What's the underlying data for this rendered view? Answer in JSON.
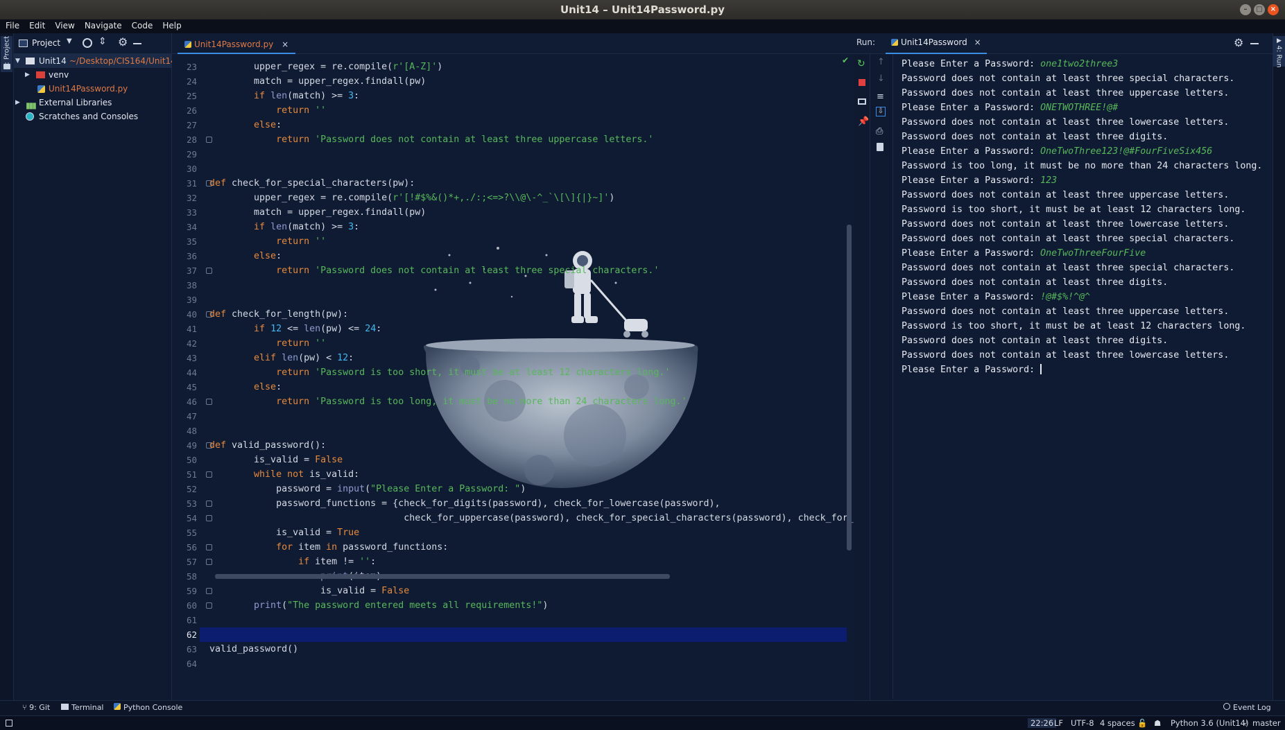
{
  "window": {
    "title": "Unit14 – Unit14Password.py"
  },
  "menu": [
    "File",
    "Edit",
    "View",
    "Navigate",
    "Code",
    "Help"
  ],
  "sidebar": {
    "project_tab": "1: Project"
  },
  "project": {
    "header": "Project",
    "root": {
      "name": "Unit14",
      "path": "~/Desktop/CIS164/Unit14"
    },
    "items": [
      {
        "label": "venv"
      },
      {
        "label": "Unit14Password.py"
      },
      {
        "label": "External Libraries"
      },
      {
        "label": "Scratches and Consoles"
      }
    ]
  },
  "editor": {
    "tab": "Unit14Password.py",
    "lines": [
      {
        "n": "23",
        "segs": [
          [
            "pl",
            "        upper_regex = re.compile("
          ],
          [
            "str",
            "r'[A-Z]'"
          ],
          [
            "pl",
            ")"
          ]
        ]
      },
      {
        "n": "24",
        "segs": [
          [
            "pl",
            "        match = upper_regex.findall(pw)"
          ]
        ]
      },
      {
        "n": "25",
        "segs": [
          [
            "kw",
            "        if "
          ],
          [
            "bi",
            "len"
          ],
          [
            "pl",
            "(match) >= "
          ],
          [
            "num",
            "3"
          ],
          [
            "pl",
            ":"
          ]
        ]
      },
      {
        "n": "26",
        "segs": [
          [
            "kw",
            "            return "
          ],
          [
            "str",
            "''"
          ]
        ]
      },
      {
        "n": "27",
        "segs": [
          [
            "kw",
            "        else"
          ],
          [
            "pl",
            ":"
          ]
        ]
      },
      {
        "n": "28",
        "segs": [
          [
            "kw",
            "            return "
          ],
          [
            "str",
            "'Password does not contain at least three uppercase letters.'"
          ]
        ]
      },
      {
        "n": "29",
        "segs": []
      },
      {
        "n": "30",
        "segs": []
      },
      {
        "n": "31",
        "segs": [
          [
            "kw",
            "def "
          ],
          [
            "fn",
            "check_for_special_characters"
          ],
          [
            "pl",
            "(pw):"
          ]
        ]
      },
      {
        "n": "32",
        "segs": [
          [
            "pl",
            "        upper_regex = re.compile("
          ],
          [
            "str",
            "r'[!#$%&()*+,./:;<=>?\\\\@\\-^_`\\[\\]{|}~]'"
          ],
          [
            "pl",
            ")"
          ]
        ]
      },
      {
        "n": "33",
        "segs": [
          [
            "pl",
            "        match = upper_regex.findall(pw)"
          ]
        ]
      },
      {
        "n": "34",
        "segs": [
          [
            "kw",
            "        if "
          ],
          [
            "bi",
            "len"
          ],
          [
            "pl",
            "(match) >= "
          ],
          [
            "num",
            "3"
          ],
          [
            "pl",
            ":"
          ]
        ]
      },
      {
        "n": "35",
        "segs": [
          [
            "kw",
            "            return "
          ],
          [
            "str",
            "''"
          ]
        ]
      },
      {
        "n": "36",
        "segs": [
          [
            "kw",
            "        else"
          ],
          [
            "pl",
            ":"
          ]
        ]
      },
      {
        "n": "37",
        "segs": [
          [
            "kw",
            "            return "
          ],
          [
            "str",
            "'Password does not contain at least three special characters.'"
          ]
        ]
      },
      {
        "n": "38",
        "segs": []
      },
      {
        "n": "39",
        "segs": []
      },
      {
        "n": "40",
        "segs": [
          [
            "kw",
            "def "
          ],
          [
            "fn",
            "check_for_length"
          ],
          [
            "pl",
            "(pw):"
          ]
        ]
      },
      {
        "n": "41",
        "segs": [
          [
            "kw",
            "        if "
          ],
          [
            "num",
            "12"
          ],
          [
            "pl",
            " <= "
          ],
          [
            "bi",
            "len"
          ],
          [
            "pl",
            "(pw) <= "
          ],
          [
            "num",
            "24"
          ],
          [
            "pl",
            ":"
          ]
        ]
      },
      {
        "n": "42",
        "segs": [
          [
            "kw",
            "            return "
          ],
          [
            "str",
            "''"
          ]
        ]
      },
      {
        "n": "43",
        "segs": [
          [
            "kw",
            "        elif "
          ],
          [
            "bi",
            "len"
          ],
          [
            "pl",
            "(pw) < "
          ],
          [
            "num",
            "12"
          ],
          [
            "pl",
            ":"
          ]
        ]
      },
      {
        "n": "44",
        "segs": [
          [
            "kw",
            "            return "
          ],
          [
            "str",
            "'Password is too short, it must be at least 12 characters long.'"
          ]
        ]
      },
      {
        "n": "45",
        "segs": [
          [
            "kw",
            "        else"
          ],
          [
            "pl",
            ":"
          ]
        ]
      },
      {
        "n": "46",
        "segs": [
          [
            "kw",
            "            return "
          ],
          [
            "str",
            "'Password is too long, it must be no more than 24 characters long.'"
          ]
        ]
      },
      {
        "n": "47",
        "segs": []
      },
      {
        "n": "48",
        "segs": []
      },
      {
        "n": "49",
        "segs": [
          [
            "kw",
            "def "
          ],
          [
            "fn",
            "valid_password"
          ],
          [
            "pl",
            "():"
          ]
        ]
      },
      {
        "n": "50",
        "segs": [
          [
            "pl",
            "        is_valid = "
          ],
          [
            "kw",
            "False"
          ]
        ]
      },
      {
        "n": "51",
        "segs": [
          [
            "kw",
            "        while not "
          ],
          [
            "pl",
            "is_valid:"
          ]
        ]
      },
      {
        "n": "52",
        "segs": [
          [
            "pl",
            "            password = "
          ],
          [
            "bi",
            "input"
          ],
          [
            "pl",
            "("
          ],
          [
            "str",
            "\"Please Enter a Password: \""
          ],
          [
            "pl",
            ")"
          ]
        ]
      },
      {
        "n": "53",
        "segs": [
          [
            "pl",
            "            password_functions = {check_for_digits(password), check_for_lowercase(password),"
          ]
        ]
      },
      {
        "n": "54",
        "segs": [
          [
            "pl",
            "                                   check_for_uppercase(password), check_for_special_characters(password), check_for_length(password)}"
          ]
        ]
      },
      {
        "n": "55",
        "segs": [
          [
            "pl",
            "            is_valid = "
          ],
          [
            "kw",
            "True"
          ]
        ]
      },
      {
        "n": "56",
        "segs": [
          [
            "kw",
            "            for "
          ],
          [
            "pl",
            "item "
          ],
          [
            "kw",
            "in "
          ],
          [
            "pl",
            "password_functions:"
          ]
        ]
      },
      {
        "n": "57",
        "segs": [
          [
            "kw",
            "                if "
          ],
          [
            "pl",
            "item != "
          ],
          [
            "str",
            "''"
          ],
          [
            "pl",
            ":"
          ]
        ]
      },
      {
        "n": "58",
        "segs": [
          [
            "bi",
            "                    print"
          ],
          [
            "pl",
            "(item)"
          ]
        ]
      },
      {
        "n": "59",
        "segs": [
          [
            "pl",
            "                    is_valid = "
          ],
          [
            "kw",
            "False"
          ]
        ]
      },
      {
        "n": "60",
        "segs": [
          [
            "bi",
            "        print"
          ],
          [
            "pl",
            "("
          ],
          [
            "str",
            "\"The password entered meets all requirements!\""
          ],
          [
            "pl",
            ")"
          ]
        ]
      },
      {
        "n": "61",
        "segs": []
      },
      {
        "n": "62",
        "segs": []
      },
      {
        "n": "63",
        "segs": [
          [
            "pl",
            "valid_password()"
          ]
        ]
      },
      {
        "n": "64",
        "segs": []
      }
    ]
  },
  "run": {
    "label": "Run:",
    "tab": "Unit14Password",
    "output": [
      [
        "Please Enter a Password: ",
        "one1two2three3"
      ],
      [
        "Password does not contain at least three special characters.",
        ""
      ],
      [
        "Password does not contain at least three uppercase letters.",
        ""
      ],
      [
        "Please Enter a Password: ",
        "ONETWOTHREE!@#"
      ],
      [
        "Password does not contain at least three lowercase letters.",
        ""
      ],
      [
        "Password does not contain at least three digits.",
        ""
      ],
      [
        "Please Enter a Password: ",
        "OneTwoThree123!@#FourFiveSix456"
      ],
      [
        "Password is too long, it must be no more than 24 characters long.",
        ""
      ],
      [
        "Please Enter a Password: ",
        "123"
      ],
      [
        "Password does not contain at least three uppercase letters.",
        ""
      ],
      [
        "Password is too short, it must be at least 12 characters long.",
        ""
      ],
      [
        "Password does not contain at least three lowercase letters.",
        ""
      ],
      [
        "Password does not contain at least three special characters.",
        ""
      ],
      [
        "Please Enter a Password: ",
        "OneTwoThreeFourFive"
      ],
      [
        "Password does not contain at least three special characters.",
        ""
      ],
      [
        "Password does not contain at least three digits.",
        ""
      ],
      [
        "Please Enter a Password: ",
        "!@#$%!^@^"
      ],
      [
        "Password does not contain at least three uppercase letters.",
        ""
      ],
      [
        "Password is too short, it must be at least 12 characters long.",
        ""
      ],
      [
        "Password does not contain at least three digits.",
        ""
      ],
      [
        "Password does not contain at least three lowercase letters.",
        ""
      ],
      [
        "Please Enter a Password: ",
        ""
      ]
    ],
    "side_tab": "4: Run"
  },
  "bottom_tools": {
    "git": "9: Git",
    "terminal": "Terminal",
    "python_console": "Python Console",
    "event_log": "Event Log"
  },
  "status": {
    "position": "22:26",
    "line_sep": "LF",
    "encoding": "UTF-8",
    "indent": "4 spaces",
    "interpreter": "Python 3.6 (Unit14)",
    "branch": "master"
  },
  "colors": {
    "background": "#0f1b33",
    "keyword": "#e88a3a",
    "string": "#57b85a",
    "number": "#42b8f0",
    "accent": "#3a8ee6"
  }
}
